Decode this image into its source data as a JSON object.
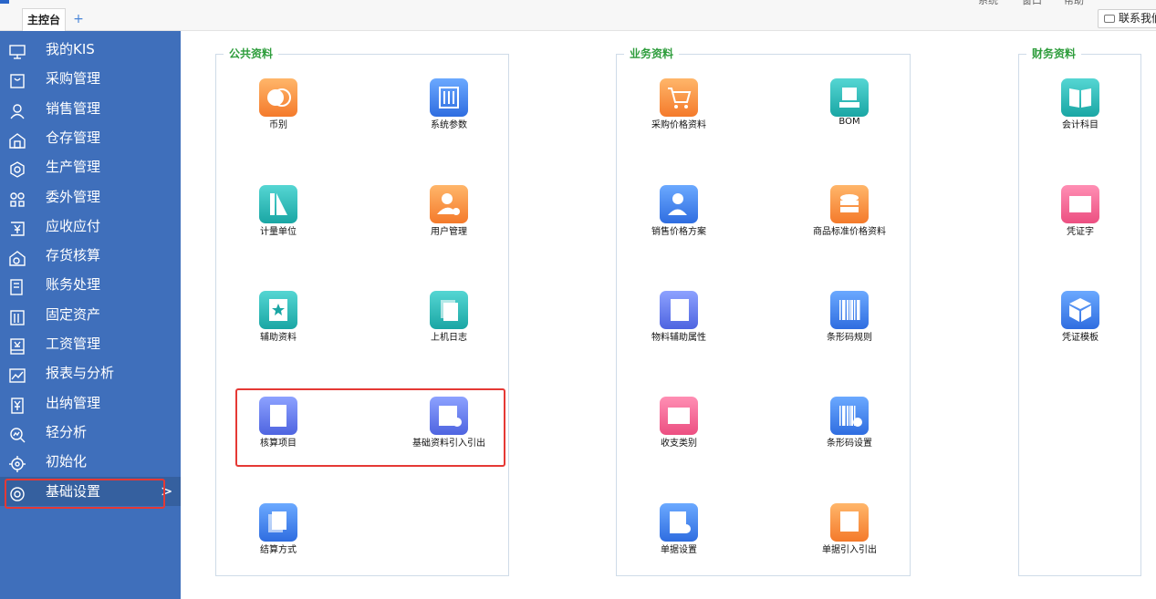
{
  "tabs": {
    "main_label": "主控台",
    "add_symbol": "+"
  },
  "contact": {
    "label": "联系我们"
  },
  "top_cut": [
    "系统",
    "窗口",
    "帮助"
  ],
  "sidebar": {
    "items": [
      {
        "label": "我的KIS",
        "icon": "monitor-icon"
      },
      {
        "label": "采购管理",
        "icon": "cart-icon"
      },
      {
        "label": "销售管理",
        "icon": "user-icon"
      },
      {
        "label": "仓存管理",
        "icon": "warehouse-icon"
      },
      {
        "label": "生产管理",
        "icon": "production-icon"
      },
      {
        "label": "委外管理",
        "icon": "outsource-icon"
      },
      {
        "label": "应收应付",
        "icon": "money-icon"
      },
      {
        "label": "存货核算",
        "icon": "inventory-icon"
      },
      {
        "label": "账务处理",
        "icon": "ledger-icon"
      },
      {
        "label": "固定资产",
        "icon": "building-icon"
      },
      {
        "label": "工资管理",
        "icon": "salary-icon"
      },
      {
        "label": "报表与分析",
        "icon": "chart-icon"
      },
      {
        "label": "出纳管理",
        "icon": "cashier-icon"
      },
      {
        "label": "轻分析",
        "icon": "analysis-icon"
      },
      {
        "label": "初始化",
        "icon": "init-icon"
      },
      {
        "label": "基础设置",
        "icon": "gear-icon",
        "active": true
      }
    ],
    "active_chevron": ">"
  },
  "panels": [
    {
      "title": "公共资料",
      "tiles": [
        {
          "label": "币别",
          "color": "orange",
          "icon": "currency-icon"
        },
        {
          "label": "系统参数",
          "color": "blue",
          "icon": "sliders-icon"
        },
        {
          "label": "计量单位",
          "color": "teal",
          "icon": "ruler-icon"
        },
        {
          "label": "用户管理",
          "color": "orange",
          "icon": "user-gear-icon"
        },
        {
          "label": "辅助资料",
          "color": "teal",
          "icon": "star-doc-icon"
        },
        {
          "label": "上机日志",
          "color": "teal",
          "icon": "log-icon"
        },
        {
          "label": "核算项目",
          "color": "purple",
          "icon": "yuan-doc-icon"
        },
        {
          "label": "基础资料引入引出",
          "color": "purple",
          "icon": "import-export-icon"
        },
        {
          "label": "结算方式",
          "color": "blue",
          "icon": "settlement-icon"
        }
      ]
    },
    {
      "title": "业务资料",
      "tiles": [
        {
          "label": "采购价格资料",
          "color": "orange",
          "icon": "cart-icon"
        },
        {
          "label": "BOM",
          "color": "teal",
          "icon": "bom-icon"
        },
        {
          "label": "销售价格方案",
          "color": "blue",
          "icon": "salesperson-icon"
        },
        {
          "label": "商品标准价格资料",
          "color": "orange",
          "icon": "coins-icon"
        },
        {
          "label": "物料辅助属性",
          "color": "purple",
          "icon": "material-icon"
        },
        {
          "label": "条形码规则",
          "color": "blue",
          "icon": "barcode-icon"
        },
        {
          "label": "收支类别",
          "color": "pink",
          "icon": "ticket-icon"
        },
        {
          "label": "条形码设置",
          "color": "blue",
          "icon": "barcode-gear-icon"
        },
        {
          "label": "单据设置",
          "color": "blue",
          "icon": "doc-gear-icon"
        },
        {
          "label": "单据引入引出",
          "color": "orange",
          "icon": "doc-export-icon"
        }
      ]
    },
    {
      "title": "财务资料",
      "tiles": [
        {
          "label": "会计科目",
          "color": "teal",
          "icon": "book-icon"
        },
        {
          "label": "凭证字",
          "color": "pink",
          "icon": "voucher-icon"
        },
        {
          "label": "凭证模板",
          "color": "blue",
          "icon": "cube-icon"
        }
      ]
    }
  ]
}
